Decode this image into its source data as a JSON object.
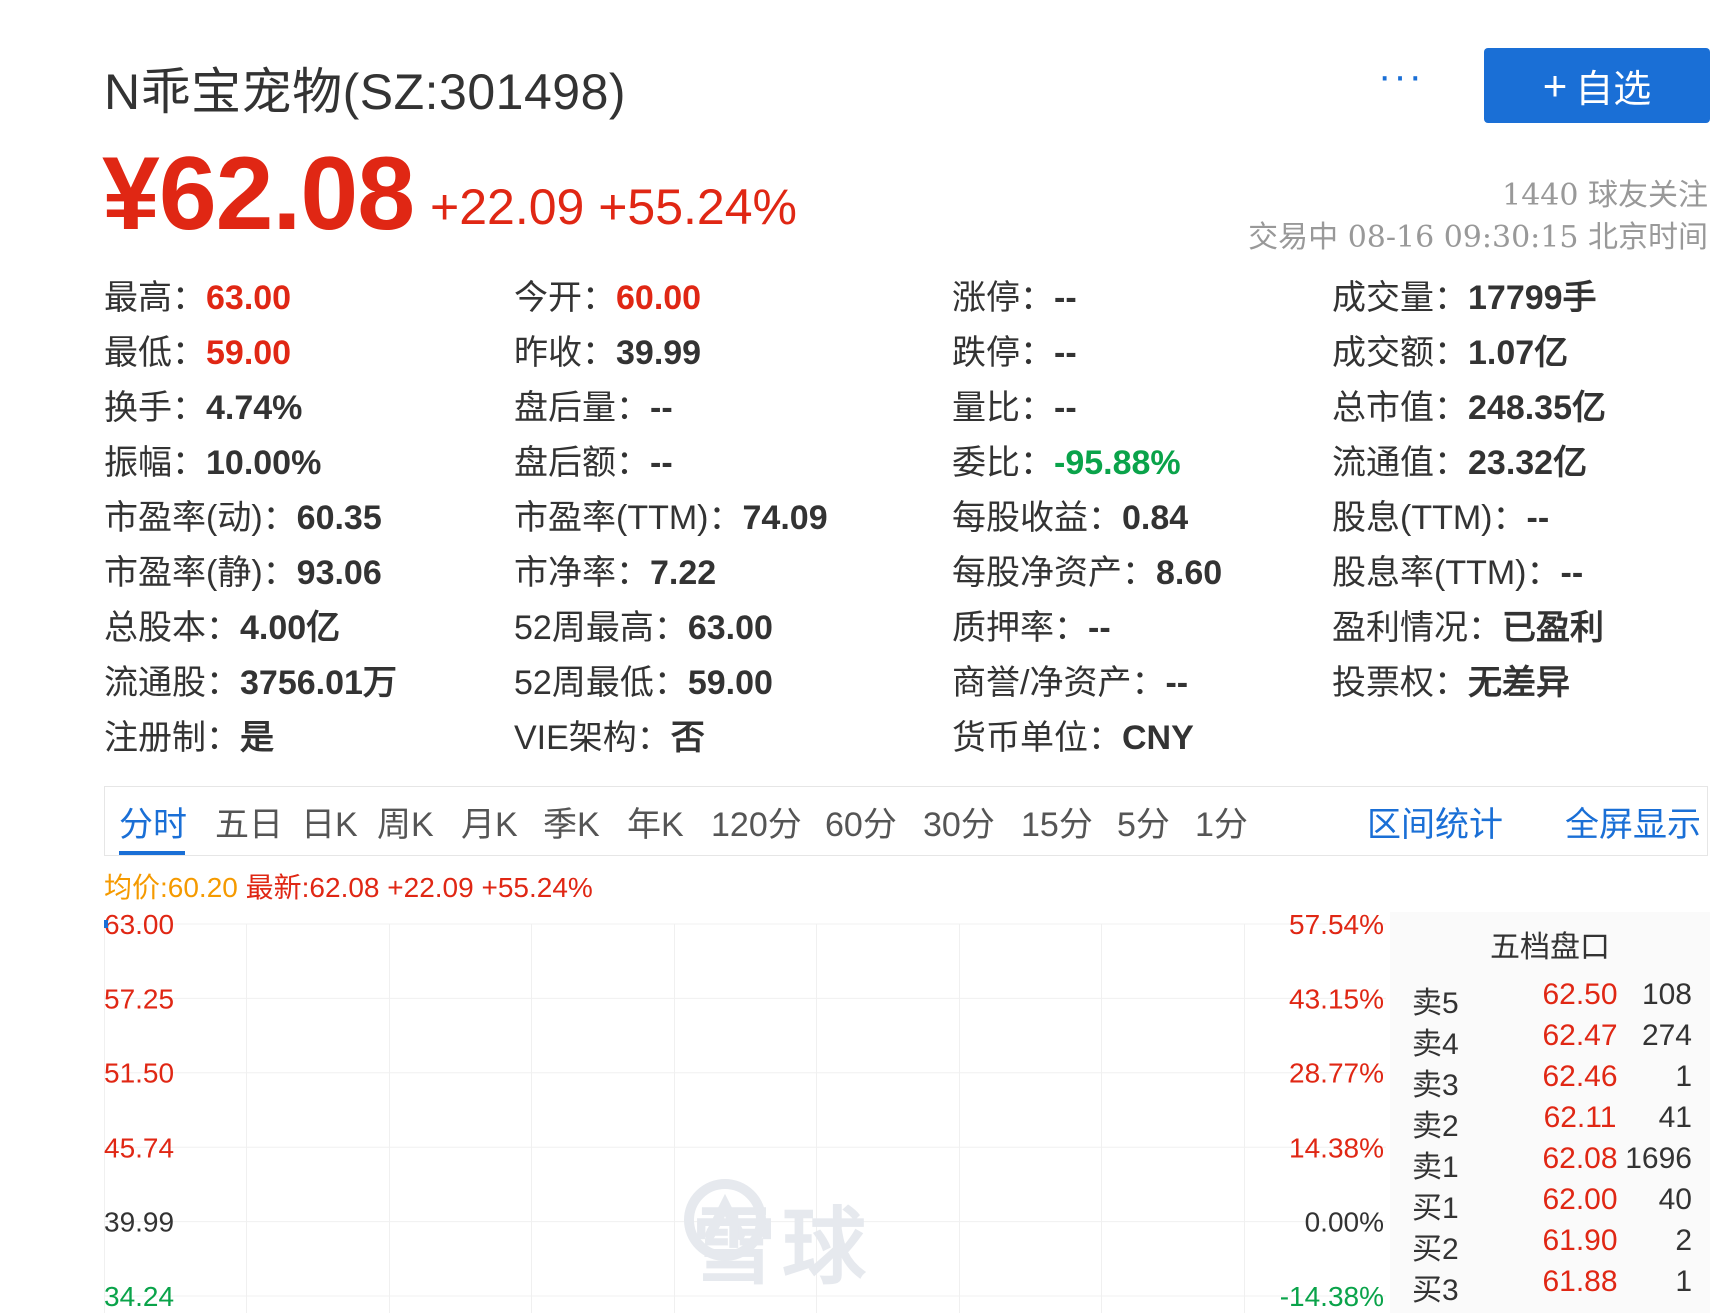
{
  "header": {
    "title": "N乖宝宠物(SZ:301498)",
    "more_label": "···",
    "follow_plus": "+",
    "follow_label": "自选"
  },
  "quote": {
    "price": "¥62.08",
    "change": "+22.09 +55.24%",
    "followers": "1440 球友关注",
    "trade_status": "交易中 08-16 09:30:15 北京时间"
  },
  "stats": {
    "high": {
      "label": "最高：",
      "value": "63.00"
    },
    "low": {
      "label": "最低：",
      "value": "59.00"
    },
    "turnover": {
      "label": "换手：",
      "value": "4.74%"
    },
    "amplitude": {
      "label": "振幅：",
      "value": "10.00%"
    },
    "pe_dyn": {
      "label": "市盈率(动)：",
      "value": "60.35"
    },
    "pe_static": {
      "label": "市盈率(静)：",
      "value": "93.06"
    },
    "total_shares": {
      "label": "总股本：",
      "value": "4.00亿"
    },
    "float_shares": {
      "label": "流通股：",
      "value": "3756.01万"
    },
    "registration": {
      "label": "注册制：",
      "value": "是"
    },
    "open": {
      "label": "今开：",
      "value": "60.00"
    },
    "prev_close": {
      "label": "昨收：",
      "value": "39.99"
    },
    "after_vol": {
      "label": "盘后量：",
      "value": "--"
    },
    "after_amt": {
      "label": "盘后额：",
      "value": "--"
    },
    "pe_ttm": {
      "label": "市盈率(TTM)：",
      "value": "74.09"
    },
    "pb": {
      "label": "市净率：",
      "value": "7.22"
    },
    "wk52_high": {
      "label": "52周最高：",
      "value": "63.00"
    },
    "wk52_low": {
      "label": "52周最低：",
      "value": "59.00"
    },
    "vie": {
      "label": "VIE架构：",
      "value": "否"
    },
    "limit_up": {
      "label": "涨停：",
      "value": "--"
    },
    "limit_down": {
      "label": "跌停：",
      "value": "--"
    },
    "vol_ratio": {
      "label": "量比：",
      "value": "--"
    },
    "commit_ratio": {
      "label": "委比：",
      "value": "-95.88%"
    },
    "eps": {
      "label": "每股收益：",
      "value": "0.84"
    },
    "bvps": {
      "label": "每股净资产：",
      "value": "8.60"
    },
    "pledge": {
      "label": "质押率：",
      "value": "--"
    },
    "goodwill": {
      "label": "商誉/净资产：",
      "value": "--"
    },
    "currency": {
      "label": "货币单位：",
      "value": "CNY"
    },
    "volume": {
      "label": "成交量：",
      "value": "17799手"
    },
    "amount": {
      "label": "成交额：",
      "value": "1.07亿"
    },
    "mkt_cap": {
      "label": "总市值：",
      "value": "248.35亿"
    },
    "float_cap": {
      "label": "流通值：",
      "value": "23.32亿"
    },
    "div_ttm": {
      "label": "股息(TTM)：",
      "value": "--"
    },
    "div_yield": {
      "label": "股息率(TTM)：",
      "value": "--"
    },
    "profit": {
      "label": "盈利情况：",
      "value": "已盈利"
    },
    "voting": {
      "label": "投票权：",
      "value": "无差异"
    }
  },
  "tabs": [
    "分时",
    "五日",
    "日K",
    "周K",
    "月K",
    "季K",
    "年K",
    "120分",
    "60分",
    "30分",
    "15分",
    "5分",
    "1分"
  ],
  "active_tab": "分时",
  "tab_actions": {
    "range_stats": "区间统计",
    "fullscreen": "全屏显示"
  },
  "summary": {
    "avg": "均价:60.20",
    "latest": "最新:62.08 +22.09 +55.24%"
  },
  "colors": {
    "red": "#e02714",
    "green": "#0aa34a",
    "blue": "#1a6fd6",
    "orange": "#f59a00"
  },
  "chart_data": {
    "type": "line",
    "y_left_labels": [
      "63.00",
      "57.25",
      "51.50",
      "45.74",
      "39.99",
      "34.24"
    ],
    "y_right_labels": [
      "57.54%",
      "43.15%",
      "28.77%",
      "14.38%",
      "0.00%",
      "-14.38%"
    ],
    "ylim": [
      34.24,
      63.0
    ],
    "reference": 39.99,
    "series": [
      {
        "values": [
          63.0
        ]
      }
    ]
  },
  "watermark": {
    "text": "雪球"
  },
  "orderbook": {
    "title": "五档盘口",
    "rows": [
      {
        "label": "卖5",
        "price": "62.50",
        "qty": "108"
      },
      {
        "label": "卖4",
        "price": "62.47",
        "qty": "274"
      },
      {
        "label": "卖3",
        "price": "62.46",
        "qty": "1"
      },
      {
        "label": "卖2",
        "price": "62.11",
        "qty": "41"
      },
      {
        "label": "卖1",
        "price": "62.08",
        "qty": "1696"
      },
      {
        "label": "买1",
        "price": "62.00",
        "qty": "40"
      },
      {
        "label": "买2",
        "price": "61.90",
        "qty": "2"
      },
      {
        "label": "买3",
        "price": "61.88",
        "qty": "1"
      }
    ]
  }
}
